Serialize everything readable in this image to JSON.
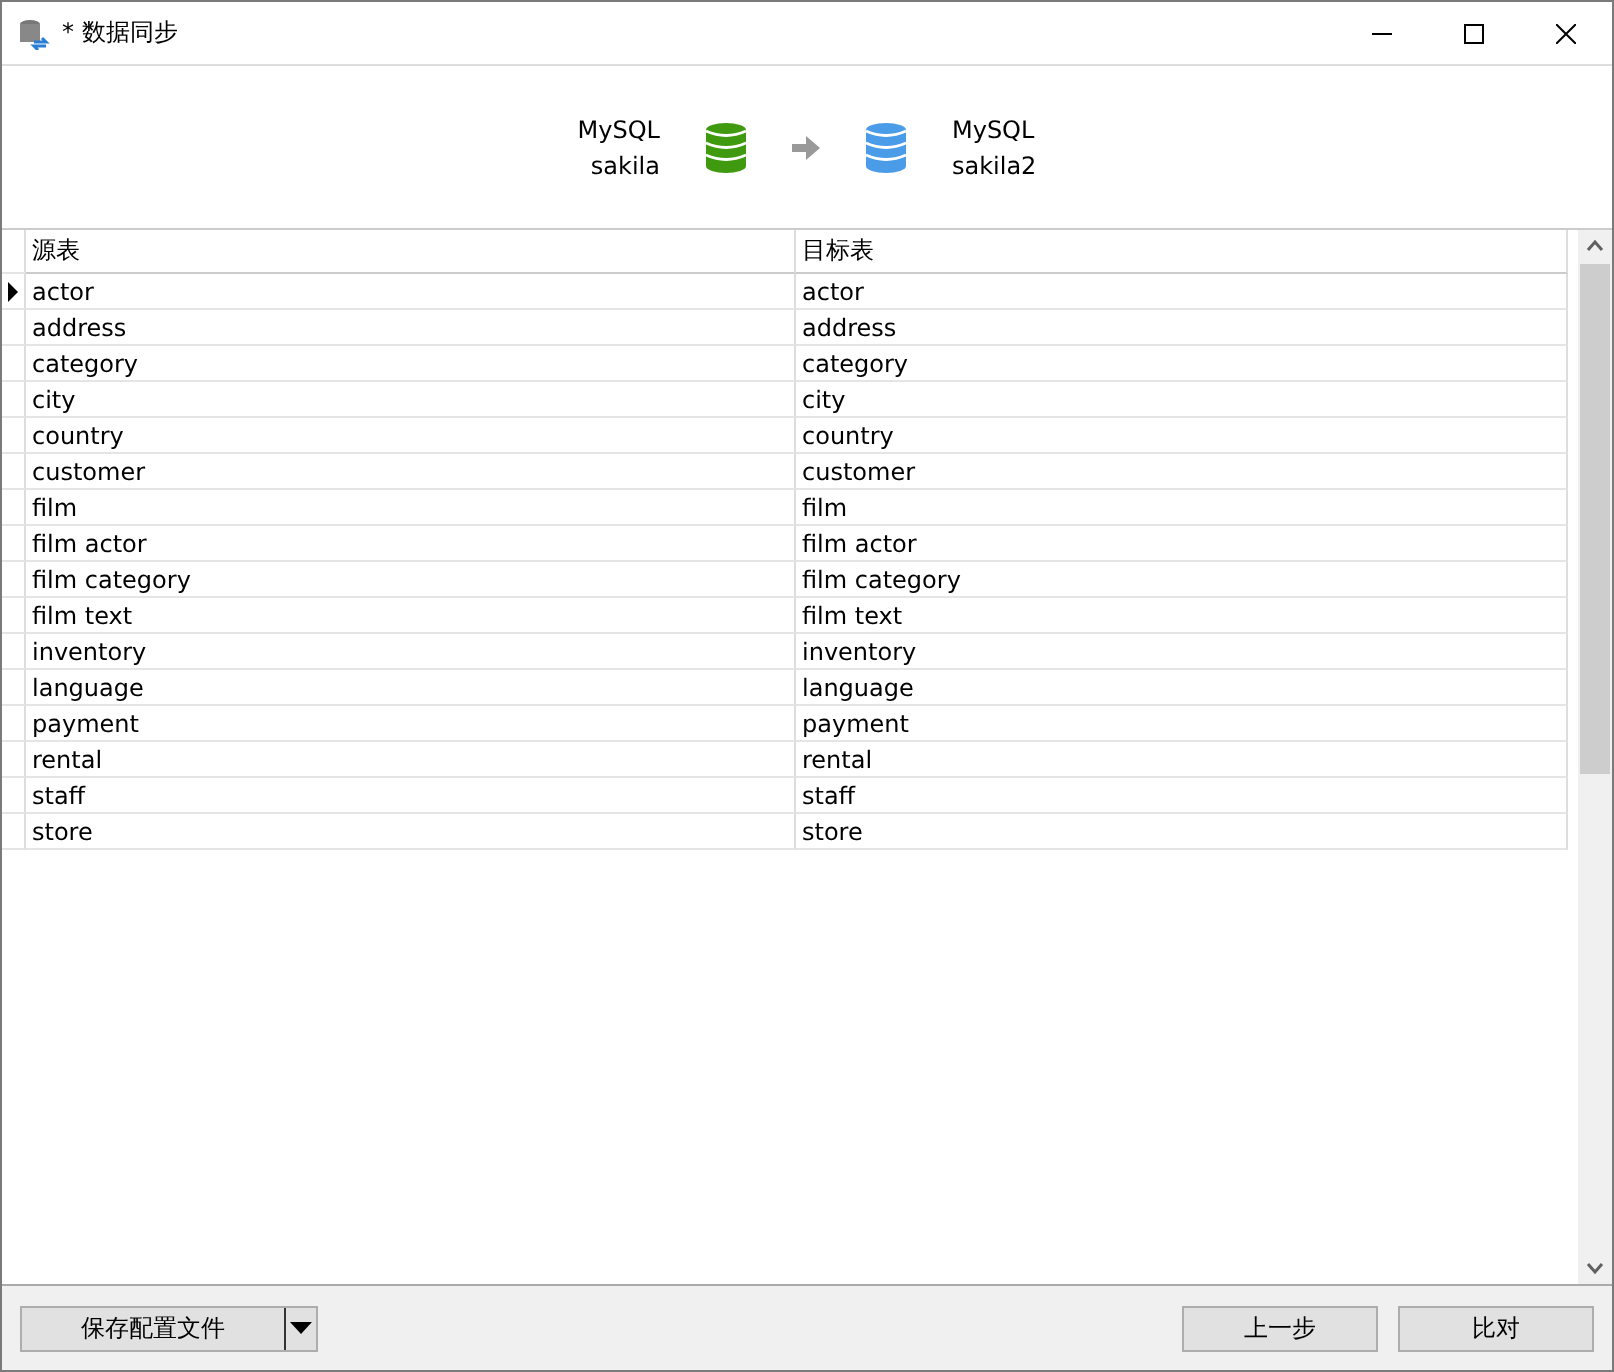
{
  "window": {
    "title": "* 数据同步"
  },
  "source": {
    "type": "MySQL",
    "name": "sakila"
  },
  "target": {
    "type": "MySQL",
    "name": "sakila2"
  },
  "table": {
    "columns": [
      "源表",
      "目标表"
    ],
    "rows": [
      {
        "source": "actor",
        "target": "actor",
        "selected": true
      },
      {
        "source": "address",
        "target": "address",
        "selected": false
      },
      {
        "source": "category",
        "target": "category",
        "selected": false
      },
      {
        "source": "city",
        "target": "city",
        "selected": false
      },
      {
        "source": "country",
        "target": "country",
        "selected": false
      },
      {
        "source": "customer",
        "target": "customer",
        "selected": false
      },
      {
        "source": "film",
        "target": "film",
        "selected": false
      },
      {
        "source": "film actor",
        "target": "film actor",
        "selected": false
      },
      {
        "source": "film category",
        "target": "film category",
        "selected": false
      },
      {
        "source": "film text",
        "target": "film text",
        "selected": false
      },
      {
        "source": "inventory",
        "target": "inventory",
        "selected": false
      },
      {
        "source": "language",
        "target": "language",
        "selected": false
      },
      {
        "source": "payment",
        "target": "payment",
        "selected": false
      },
      {
        "source": "rental",
        "target": "rental",
        "selected": false
      },
      {
        "source": "staff",
        "target": "staff",
        "selected": false
      },
      {
        "source": "store",
        "target": "store",
        "selected": false
      }
    ]
  },
  "footer": {
    "save_button": "保存配置文件",
    "back_button": "上一步",
    "compare_button": "比对"
  }
}
